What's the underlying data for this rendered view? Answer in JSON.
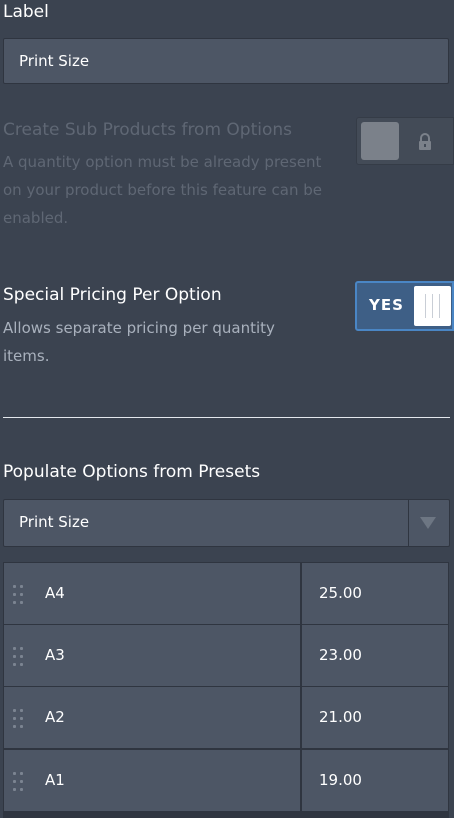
{
  "label_field": {
    "title": "Label",
    "value": "Print Size"
  },
  "sub_products": {
    "title": "Create Sub Products from Options",
    "description": "A quantity option must be already present on your product before this feature can be enabled.",
    "toggle": {
      "state": "disabled",
      "icon": "lock-icon"
    }
  },
  "special_pricing": {
    "title": "Special Pricing Per Option",
    "description": "Allows separate pricing per quantity items.",
    "toggle": {
      "state": "on",
      "label": "YES"
    }
  },
  "presets": {
    "title": "Populate Options from Presets",
    "selected": "Print Size"
  },
  "options": [
    {
      "name": "A4",
      "price": "25.00"
    },
    {
      "name": "A3",
      "price": "23.00"
    },
    {
      "name": "A2",
      "price": "21.00"
    },
    {
      "name": "A1",
      "price": "19.00"
    }
  ],
  "colors": {
    "background": "#3b4350",
    "field": "#4d5665",
    "toggle_on_border": "#4a86c5",
    "toggle_on_fill": "#3e5f86"
  }
}
